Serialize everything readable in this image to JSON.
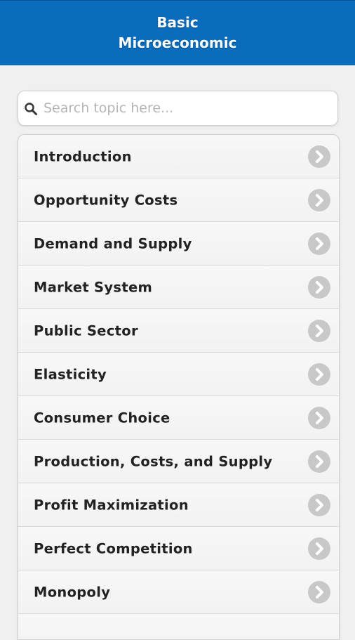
{
  "header": {
    "title_line1": "Basic",
    "title_line2": "Microeconomic"
  },
  "search": {
    "placeholder": "Search topic here...",
    "icon": "search-icon"
  },
  "topics": [
    {
      "label": "Introduction"
    },
    {
      "label": "Opportunity Costs"
    },
    {
      "label": "Demand and Supply"
    },
    {
      "label": "Market System"
    },
    {
      "label": "Public Sector"
    },
    {
      "label": "Elasticity"
    },
    {
      "label": "Consumer Choice"
    },
    {
      "label": "Production, Costs, and Supply"
    },
    {
      "label": "Profit Maximization"
    },
    {
      "label": "Perfect Competition"
    },
    {
      "label": "Monopoly"
    },
    {
      "label": ""
    }
  ],
  "colors": {
    "header_bg": "#0a6cbd",
    "list_bg": "#f5f5f5",
    "chevron_bg": "#c8c8c8"
  }
}
